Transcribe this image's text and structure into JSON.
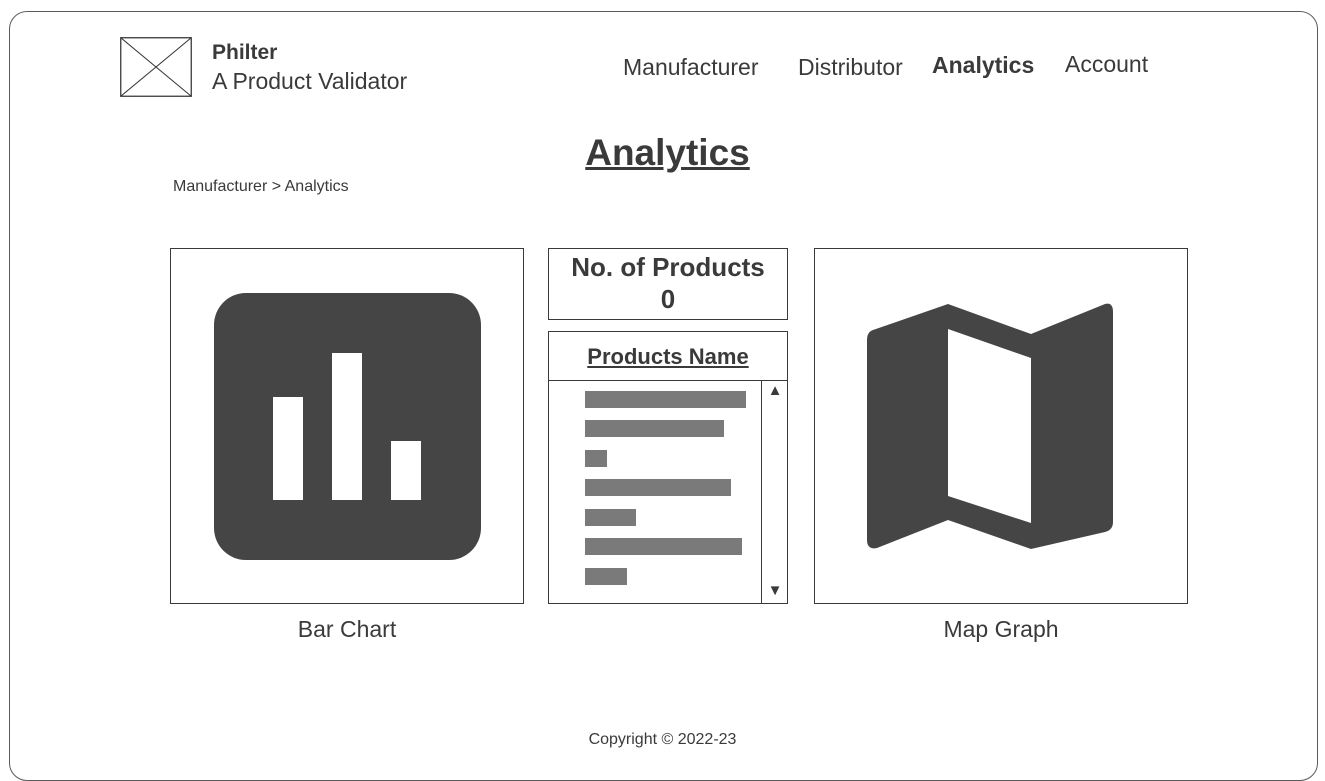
{
  "brand": {
    "name": "Philter",
    "tagline": "A Product Validator",
    "logo_icon": "image-placeholder-icon"
  },
  "nav": {
    "items": [
      {
        "label": "Manufacturer",
        "active": false
      },
      {
        "label": "Distributor",
        "active": false
      },
      {
        "label": "Analytics",
        "active": true
      },
      {
        "label": "Account",
        "active": false
      }
    ]
  },
  "page": {
    "title": "Analytics",
    "breadcrumb": "Manufacturer > Analytics"
  },
  "bar_chart_card": {
    "caption": "Bar Chart",
    "icon": "bar-chart-icon"
  },
  "products_count": {
    "label": "No. of Products",
    "value": "0"
  },
  "products_list": {
    "header": "Products Name",
    "scroll_up_glyph": "▲",
    "scroll_down_glyph": "▼"
  },
  "map_card": {
    "caption": "Map Graph",
    "icon": "map-icon"
  },
  "footer": {
    "copyright": "Copyright © 2022-23"
  },
  "colors": {
    "icon_fill": "#454545",
    "placeholder_bar": "#7a7a7a",
    "text": "#3a3a3a",
    "border": "#3a3a3a"
  }
}
